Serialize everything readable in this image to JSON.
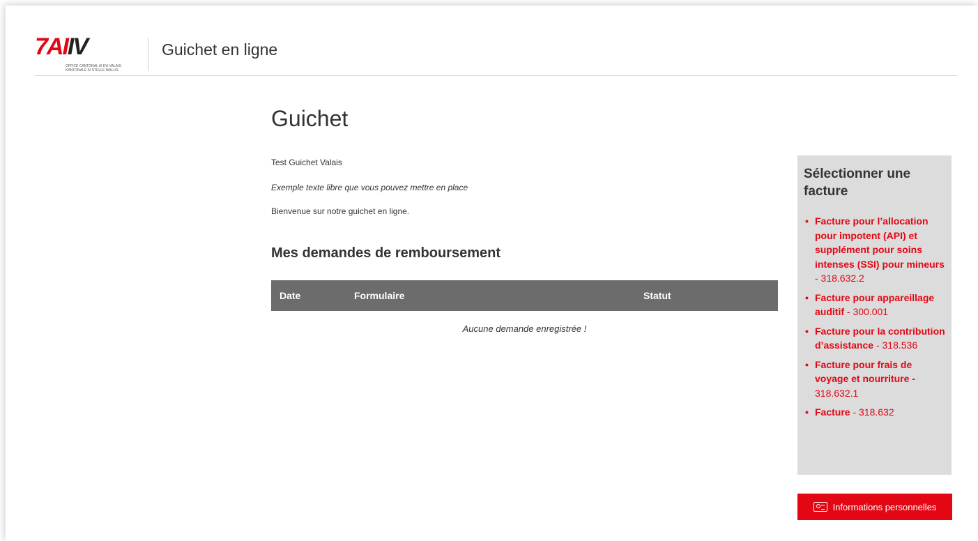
{
  "header": {
    "logo_text_part1": "7",
    "logo_text_part2": "AI",
    "logo_text_part3": "IV",
    "logo_subtitle": "OFFICE CANTONAL AI DU VALAIS\nKANTONALE IV-STELLE WALLIS",
    "title": "Guichet en ligne"
  },
  "main": {
    "page_title": "Guichet",
    "intro_line1": "Test Guichet Valais",
    "intro_line2": "Exemple texte libre que vous pouvez mettre en place",
    "intro_line3": "Bienvenue sur notre guichet en ligne.",
    "section_title": "Mes demandes de remboursement",
    "table": {
      "columns": [
        "Date",
        "Formulaire",
        "Statut"
      ],
      "empty_message": "Aucune demande enregistrée !"
    }
  },
  "sidebar": {
    "title": "Sélectionner une facture",
    "items": [
      {
        "name": "Facture pour l’allocation pour impotent (API) et supplément pour soins intenses (SSI) pour mineurs",
        "code": "- 318.632.2"
      },
      {
        "name": "Facture pour appareillage auditif",
        "code": "- 300.001"
      },
      {
        "name": "Facture pour la contribution d’assistance",
        "code": "- 318.536"
      },
      {
        "name": "Facture pour frais de voyage et nourriture -",
        "code": "318.632.1"
      },
      {
        "name": "Facture",
        "code": "- 318.632"
      }
    ]
  },
  "personal_info_button": {
    "label": "Informations personnelles",
    "icon": "id-card-icon"
  },
  "colors": {
    "accent": "#e30613",
    "table_header": "#6c6c6c",
    "sidebar_bg": "#dcdcdc"
  }
}
